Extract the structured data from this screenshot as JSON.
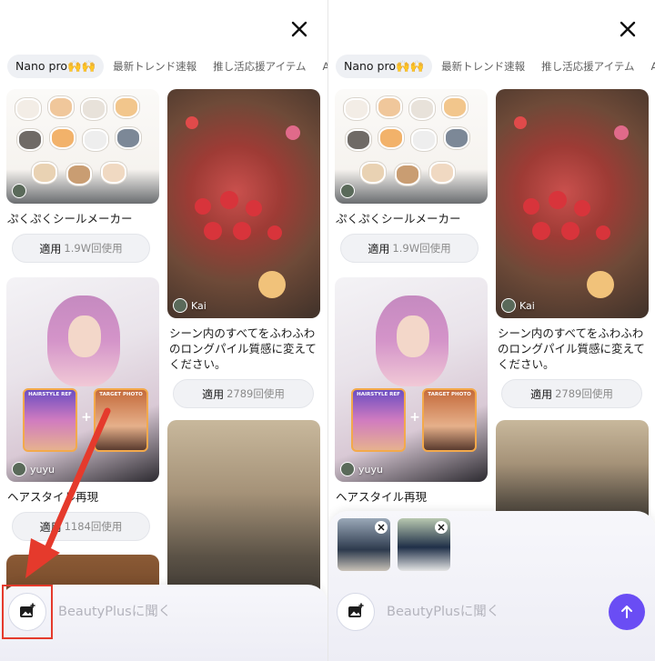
{
  "close_label": "",
  "tabs": [
    {
      "label": "Nano pro🙌🙌",
      "active": true
    },
    {
      "label": "最新トレンド速報",
      "active": false
    },
    {
      "label": "推し活応援アイテム",
      "active": false
    },
    {
      "label": "AI",
      "active": false
    }
  ],
  "cards": {
    "stickers": {
      "title": "ぷくぷくシールメーカー",
      "apply_label": "適用",
      "usage": "1.9W回使用"
    },
    "cake": {
      "title": "シーン内のすべてをふわふわのロングパイル質感に変えてください。",
      "apply_label": "適用",
      "usage": "2789回使用",
      "author": "Kai"
    },
    "hair": {
      "title": "ヘアスタイル再現",
      "apply_label": "適用",
      "usage": "1184回使用",
      "author": "yuyu",
      "ref_tag": "HAIRSTYLE REF",
      "target_tag": "TARGET PHOTO"
    }
  },
  "chat": {
    "placeholder": "BeautyPlusに聞く"
  },
  "colors": {
    "accent": "#6a4df4",
    "highlight": "#e53a2c"
  }
}
